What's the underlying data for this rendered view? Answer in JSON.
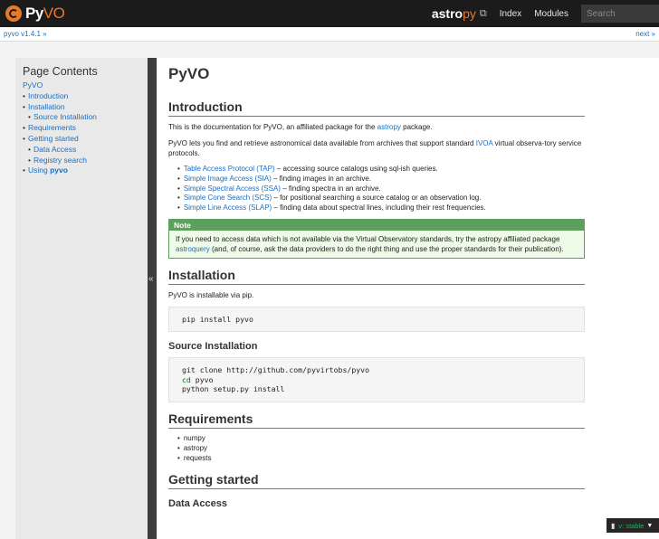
{
  "header": {
    "logo_py": "Py",
    "logo_vo": "VO",
    "astro_brand": "astro",
    "astro_py": "py",
    "nav": [
      "Index",
      "Modules"
    ],
    "search_placeholder": "Search"
  },
  "relbar": {
    "crumb": "pyvo v1.4.1 »",
    "next": "next »"
  },
  "sidebar": {
    "title": "Page Contents",
    "toc_root": "PyVO",
    "items": [
      {
        "label": "Introduction",
        "level": 1
      },
      {
        "label": "Installation",
        "level": 1
      },
      {
        "label": "Source Installation",
        "level": 2
      },
      {
        "label": "Requirements",
        "level": 1
      },
      {
        "label": "Getting started",
        "level": 1
      },
      {
        "label": "Data Access",
        "level": 2
      },
      {
        "label": "Registry search",
        "level": 2
      }
    ],
    "using_prefix": "Using ",
    "using_bold": "pyvo",
    "collapse_glyph": "«"
  },
  "main": {
    "title": "PyVO",
    "intro": {
      "heading": "Introduction",
      "p1_pre": "This is the documentation for PyVO, an affiliated package for the ",
      "p1_link": "astropy",
      "p1_post": " package.",
      "p2_pre": "PyVO lets you find and retrieve astronomical data available from archives that support standard ",
      "p2_link": "IVOA",
      "p2_post": " virtual observa-tory service protocols.",
      "services": [
        {
          "link": "Table Access Protocol (TAP)",
          "desc": " – accessing source catalogs using sql-ish queries."
        },
        {
          "link": "Simple Image Access (SIA)",
          "desc": " – finding images in an archive."
        },
        {
          "link": "Simple Spectral Access (SSA)",
          "desc": " – finding spectra in an archive."
        },
        {
          "link": "Simple Cone Search (SCS)",
          "desc": " – for positional searching a source catalog or an observation log."
        },
        {
          "link": "Simple Line Access (SLAP)",
          "desc": " – finding data about spectral lines, including their rest frequencies."
        }
      ],
      "note_title": "Note",
      "note_pre": "If you need to access data which is not available via the Virtual Observatory standards, try the astropy affiliated package ",
      "note_link": "astroquery",
      "note_post": " (and, of course, ask the data providers to do the right thing and use the proper standards for their publication)."
    },
    "installation": {
      "heading": "Installation",
      "text": "PyVO is installable via pip.",
      "cmd": "pip install pyvo"
    },
    "source_install": {
      "heading": "Source Installation",
      "line1": "git clone http://github.com/pyvirtobs/pyvo",
      "line2_kw": "cd",
      "line2_rest": " pyvo",
      "line3": "python setup.py install"
    },
    "requirements": {
      "heading": "Requirements",
      "items": [
        "numpy",
        "astropy",
        "requests"
      ]
    },
    "getting_started": {
      "heading": "Getting started",
      "sub": "Data Access"
    }
  },
  "version_badge": {
    "label": "v: stable"
  }
}
